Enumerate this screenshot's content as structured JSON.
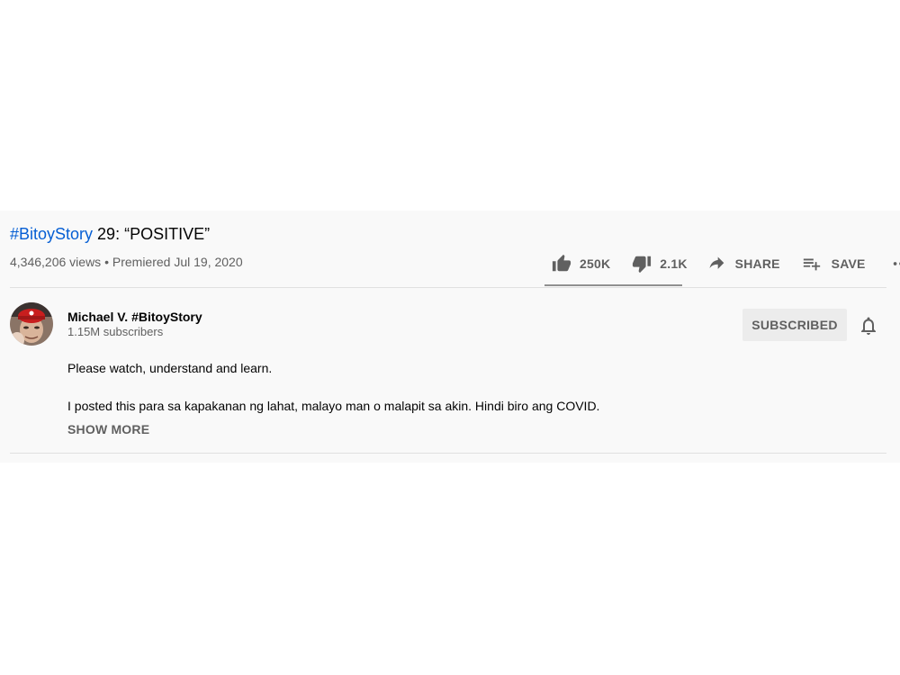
{
  "video": {
    "title_hashtag": "#BitoyStory",
    "title_rest": " 29: “POSITIVE”",
    "views": "4,346,206 views",
    "separator": " • ",
    "premiered": "Premiered Jul 19, 2020"
  },
  "actions": {
    "like_count": "250K",
    "dislike_count": "2.1K",
    "share_label": "SHARE",
    "save_label": "SAVE",
    "like_ratio": 0.99
  },
  "channel": {
    "name": "Michael V. #BitoyStory",
    "subscribers": "1.15M subscribers",
    "subscribe_label": "SUBSCRIBED"
  },
  "description": {
    "line1": "Please watch, understand and learn.",
    "line2": "I posted this para sa kapakanan ng lahat, malayo man o malapit sa akin. Hindi biro ang COVID.",
    "show_more": "SHOW MORE"
  },
  "colors": {
    "link": "#065fd4",
    "secondary_text": "#606060",
    "panel_bg": "#f9f9f9"
  }
}
